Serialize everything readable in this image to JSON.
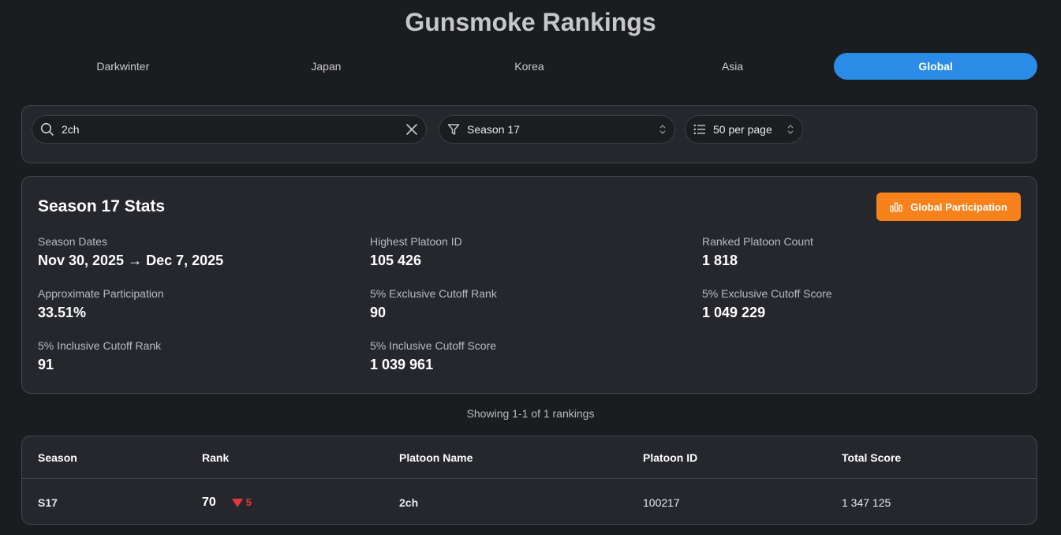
{
  "page": {
    "title": "Gunsmoke Rankings"
  },
  "tabs": [
    {
      "label": "Darkwinter",
      "active": false
    },
    {
      "label": "Japan",
      "active": false
    },
    {
      "label": "Korea",
      "active": false
    },
    {
      "label": "Asia",
      "active": false
    },
    {
      "label": "Global",
      "active": true
    }
  ],
  "filters": {
    "search": {
      "value": "2ch",
      "icon": "search-icon",
      "clear_icon": "close-icon"
    },
    "season": {
      "value": "Season 17",
      "icon": "filter-icon"
    },
    "per_page": {
      "value": "50 per page",
      "icon": "list-icon"
    }
  },
  "stats": {
    "title": "Season 17 Stats",
    "participation_button": {
      "label": "Global Participation",
      "icon": "bar-chart-icon"
    },
    "items": [
      {
        "label": "Season Dates",
        "value": "Nov 30, 2025 → Dec 7, 2025"
      },
      {
        "label": "Highest Platoon ID",
        "value": "105 426"
      },
      {
        "label": "Ranked Platoon Count",
        "value": "1 818"
      },
      {
        "label": "Approximate Participation",
        "value": "33.51%"
      },
      {
        "label": "5% Exclusive Cutoff Rank",
        "value": "90"
      },
      {
        "label": "5% Exclusive Cutoff Score",
        "value": "1 049 229"
      },
      {
        "label": "5% Inclusive Cutoff Rank",
        "value": "91"
      },
      {
        "label": "5% Inclusive Cutoff Score",
        "value": "1 039 961"
      }
    ]
  },
  "results": {
    "summary": "Showing 1-1 of 1 rankings"
  },
  "table": {
    "columns": [
      "Season",
      "Rank",
      "Platoon Name",
      "Platoon ID",
      "Total Score"
    ],
    "rows": [
      {
        "season": "S17",
        "rank": "70",
        "rank_change": "5",
        "rank_change_direction": "down",
        "platoon_name": "2ch",
        "platoon_id": "100217",
        "total_score": "1 347 125"
      }
    ]
  },
  "colors": {
    "background": "#1b1c1f",
    "panel": "#25272d",
    "accent_blue": "#2a8ce6",
    "accent_orange": "#f7821c",
    "rank_down": "#e8373b"
  }
}
